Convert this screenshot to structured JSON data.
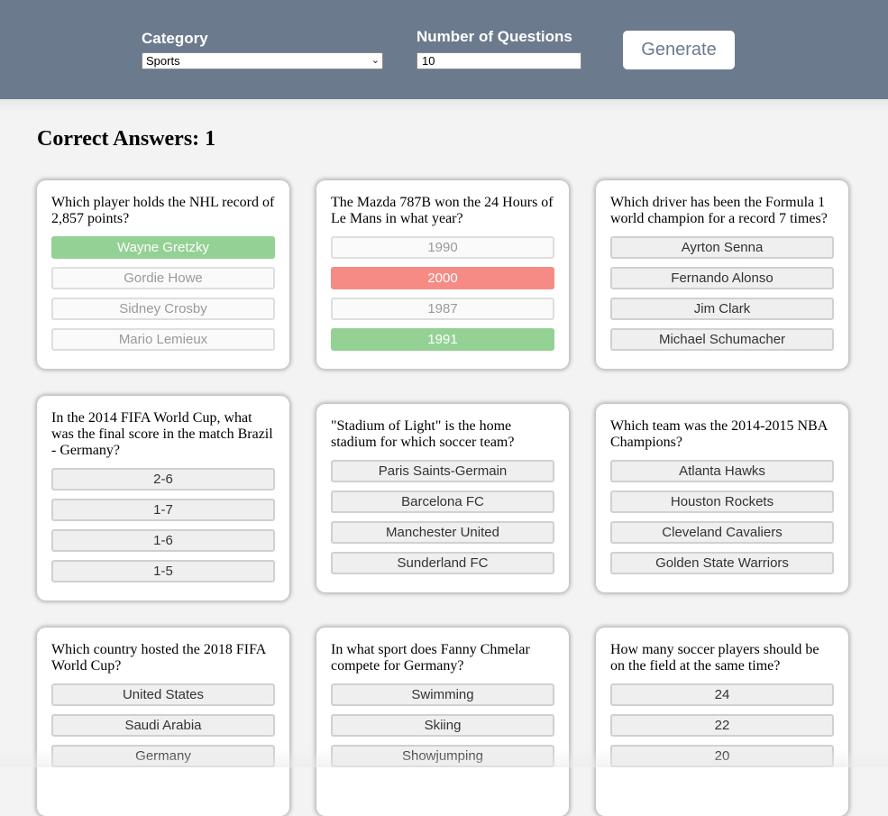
{
  "header": {
    "category_label": "Category",
    "category_value": "Sports",
    "num_label": "Number of Questions",
    "num_value": "10",
    "generate_label": "Generate"
  },
  "score": {
    "text": "Correct Answers: 1"
  },
  "cards": [
    {
      "question": "Which player holds the NHL record of 2,857 points?",
      "answers": [
        "Wayne Gretzky",
        "Gordie Howe",
        "Sidney Crosby",
        "Mario Lemieux"
      ],
      "states": [
        "correct",
        "muted",
        "muted",
        "muted"
      ]
    },
    {
      "question": "The Mazda 787B won the 24 Hours of Le Mans in what year?",
      "answers": [
        "1990",
        "2000",
        "1987",
        "1991"
      ],
      "states": [
        "muted",
        "wrong",
        "muted",
        "correct"
      ]
    },
    {
      "question": "Which driver has been the Formula 1 world champion for a record 7 times?",
      "answers": [
        "Ayrton Senna",
        "Fernando Alonso",
        "Jim Clark",
        "Michael Schumacher"
      ],
      "states": [
        "",
        "",
        "",
        ""
      ]
    },
    {
      "question": "In the 2014 FIFA World Cup, what was the final score in the match Brazil - Germany?",
      "answers": [
        "2-6",
        "1-7",
        "1-6",
        "1-5"
      ],
      "states": [
        "",
        "",
        "",
        ""
      ]
    },
    {
      "question": "\"Stadium of Light\" is the home stadium for which soccer team?",
      "answers": [
        "Paris Saints-Germain",
        "Barcelona FC",
        "Manchester United",
        "Sunderland FC"
      ],
      "states": [
        "",
        "",
        "",
        ""
      ]
    },
    {
      "question": "Which team was the 2014-2015 NBA Champions?",
      "answers": [
        "Atlanta Hawks",
        "Houston Rockets",
        "Cleveland Cavaliers",
        "Golden State Warriors"
      ],
      "states": [
        "",
        "",
        "",
        ""
      ]
    },
    {
      "question": "Which country hosted the 2018 FIFA World Cup?",
      "answers": [
        "United States",
        "Saudi Arabia",
        "Germany"
      ],
      "states": [
        "",
        "",
        ""
      ]
    },
    {
      "question": "In what sport does Fanny Chmelar compete for Germany?",
      "answers": [
        "Swimming",
        "Skiing",
        "Showjumping"
      ],
      "states": [
        "",
        "",
        ""
      ]
    },
    {
      "question": "How many soccer players should be on the field at the same time?",
      "answers": [
        "24",
        "22",
        "20"
      ],
      "states": [
        "",
        "",
        ""
      ]
    }
  ]
}
